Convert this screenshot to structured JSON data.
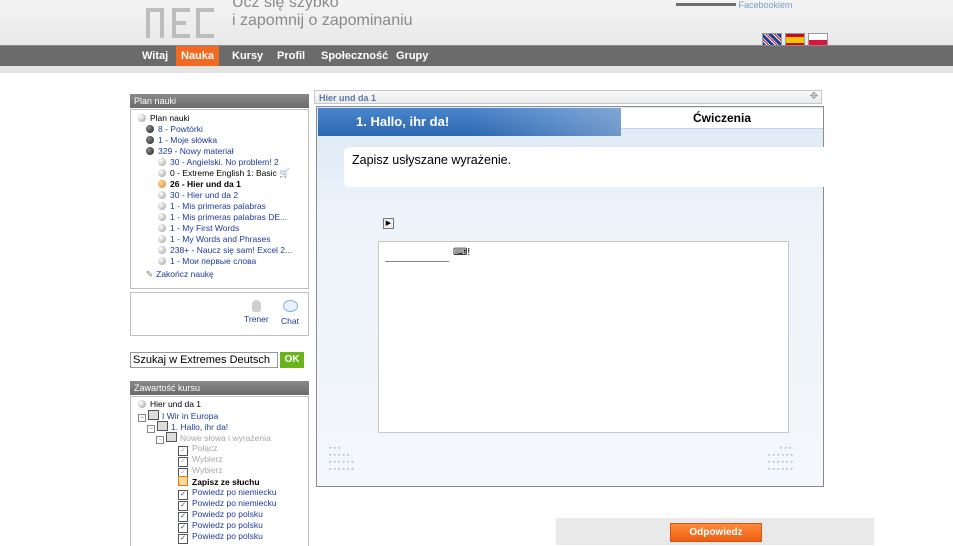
{
  "header": {
    "tagline_line1": "Ucz się szybko",
    "tagline_line2": "i zapomnij o zapominaniu",
    "facebook_text": "Facebookiem",
    "flags": [
      "en-flag",
      "es-flag",
      "pl-flag"
    ]
  },
  "nav": {
    "items": [
      {
        "label": "Witaj",
        "active": false
      },
      {
        "label": "Nauka",
        "active": true
      },
      {
        "label": "Kursy",
        "active": false
      },
      {
        "label": "Profil",
        "active": false
      },
      {
        "label": "Społeczność",
        "active": false
      },
      {
        "label": "Grupy",
        "active": false
      }
    ]
  },
  "study_plan": {
    "title": "Plan nauki",
    "root": "Plan nauki",
    "items": [
      "8 - Powtórki",
      "1 - Moje słówka",
      "329 - Nowy materiał",
      "30 - Angielski. No problem! 2",
      "0 - Extreme English 1: Basic",
      "26 - Hier und da 1",
      "30 - Hier und da 2",
      "1 - Mis primeras palabras",
      "1 - Mis primeras palabras DE...",
      "1 - My First Words",
      "1 - My Words and Phrases",
      "238+ - Naucz się sam! Excel 2...",
      "1 - Мои первые слова"
    ],
    "finish": "Zakończ naukę"
  },
  "assistant": {
    "trainer": "Trener",
    "chat": "Chat"
  },
  "search": {
    "value": "Szukaj w Extremes Deutsch",
    "ok": "OK"
  },
  "course_contents": {
    "title": "Zawartość kursu",
    "root": "Hier und da 1",
    "items": [
      "I Wir in Europa",
      "1. Hallo, ihr da!",
      "Nowe słowa i wyrażenia",
      "Połącz",
      "Wybierz",
      "Wybierz",
      "Zapisz ze słuchu",
      "Powiedz po niemiecku",
      "Powiedz po niemiecku",
      "Powiedz po polsku",
      "Powiedz po polsku",
      "Powiedz po polsku"
    ]
  },
  "exercise": {
    "window_title": "Hier und da 1",
    "lesson_title": "1. Hallo, ihr da!",
    "tab_label": "Ćwiczenia",
    "instruction": "Zapisz usłyszane wyrażenie.",
    "keyboard_symbol": "⌨!",
    "answer_button": "Odpowiedz"
  },
  "colors": {
    "accent": "#f26a21",
    "nav_bg": "#6b6b6b",
    "lesson_blue": "#3a76c0",
    "ok_green": "#68b51b"
  }
}
